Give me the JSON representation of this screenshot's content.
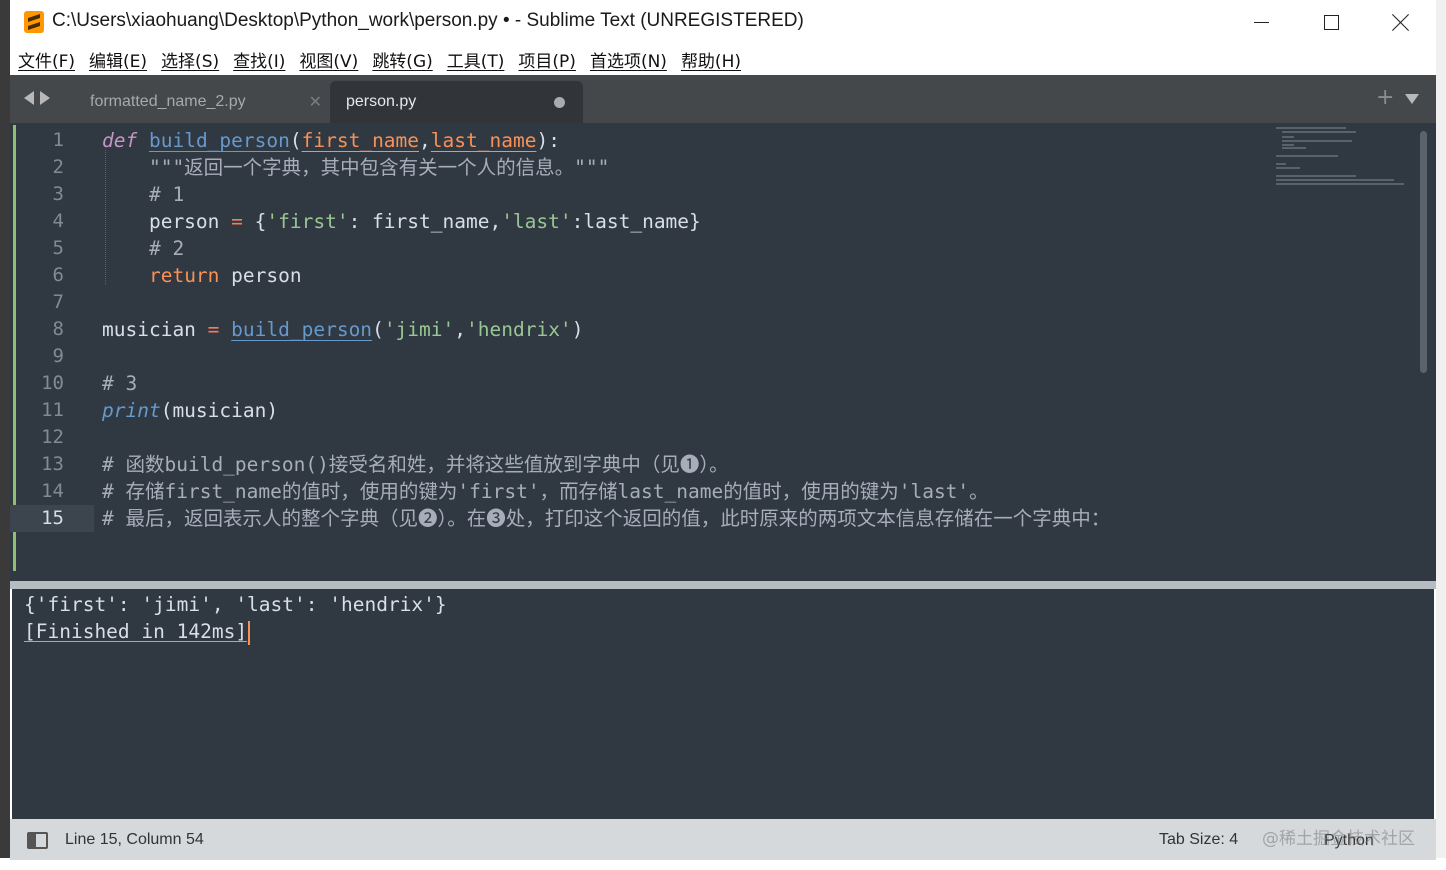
{
  "window": {
    "title": "C:\\Users\\xiaohuang\\Desktop\\Python_work\\person.py • - Sublime Text (UNREGISTERED)"
  },
  "menu": [
    "文件(F)",
    "编辑(E)",
    "选择(S)",
    "查找(I)",
    "视图(V)",
    "跳转(G)",
    "工具(T)",
    "项目(P)",
    "首选项(N)",
    "帮助(H)"
  ],
  "tabs": [
    {
      "label": "formatted_name_2.py",
      "active": false,
      "dirty": false
    },
    {
      "label": "person.py",
      "active": true,
      "dirty": true
    }
  ],
  "editor": {
    "current_line": 15,
    "line_numbers": [
      "1",
      "2",
      "3",
      "4",
      "5",
      "6",
      "7",
      "8",
      "9",
      "10",
      "11",
      "12",
      "13",
      "14",
      "15"
    ],
    "lines": [
      {
        "num": "1",
        "tokens": [
          {
            "t": "def",
            "c": "kw"
          },
          {
            "t": " ",
            "c": "pl"
          },
          {
            "t": "build_person",
            "c": "fn"
          },
          {
            "t": "(",
            "c": "pl"
          },
          {
            "t": "first_name",
            "c": "param"
          },
          {
            "t": ",",
            "c": "pl"
          },
          {
            "t": "last_name",
            "c": "param"
          },
          {
            "t": "):",
            "c": "pl"
          }
        ]
      },
      {
        "num": "2",
        "tokens": [
          {
            "t": "    \"\"\"返回一个字典，其中包含有关一个人的信息。\"\"\"",
            "c": "cmt"
          }
        ]
      },
      {
        "num": "3",
        "tokens": [
          {
            "t": "    # 1",
            "c": "cmt"
          }
        ]
      },
      {
        "num": "4",
        "tokens": [
          {
            "t": "    person ",
            "c": "pl"
          },
          {
            "t": "=",
            "c": "op"
          },
          {
            "t": " {",
            "c": "pl"
          },
          {
            "t": "'first'",
            "c": "str"
          },
          {
            "t": ": first_name,",
            "c": "pl"
          },
          {
            "t": "'last'",
            "c": "str"
          },
          {
            "t": ":last_name}",
            "c": "pl"
          }
        ]
      },
      {
        "num": "5",
        "tokens": [
          {
            "t": "    # 2",
            "c": "cmt"
          }
        ]
      },
      {
        "num": "6",
        "tokens": [
          {
            "t": "    ",
            "c": "pl"
          },
          {
            "t": "return",
            "c": "ret"
          },
          {
            "t": " person",
            "c": "pl"
          }
        ]
      },
      {
        "num": "7",
        "tokens": []
      },
      {
        "num": "8",
        "tokens": [
          {
            "t": "musician ",
            "c": "pl"
          },
          {
            "t": "=",
            "c": "op"
          },
          {
            "t": " ",
            "c": "pl"
          },
          {
            "t": "build_person",
            "c": "fn"
          },
          {
            "t": "(",
            "c": "pl"
          },
          {
            "t": "'jimi'",
            "c": "str"
          },
          {
            "t": ",",
            "c": "pl"
          },
          {
            "t": "'hendrix'",
            "c": "str"
          },
          {
            "t": ")",
            "c": "pl"
          }
        ]
      },
      {
        "num": "9",
        "tokens": []
      },
      {
        "num": "10",
        "tokens": [
          {
            "t": "# 3",
            "c": "cmt"
          }
        ]
      },
      {
        "num": "11",
        "tokens": [
          {
            "t": "print",
            "c": "bi"
          },
          {
            "t": "(musician)",
            "c": "pl"
          }
        ]
      },
      {
        "num": "12",
        "tokens": []
      },
      {
        "num": "13",
        "tokens": [
          {
            "t": "# 函数build_person()接受名和姓，并将这些值放到字典中（见❶）。",
            "c": "cmt"
          }
        ]
      },
      {
        "num": "14",
        "tokens": [
          {
            "t": "# 存储first_name的值时，使用的键为'first'，而存储last_name的值时，使用的键为'last'。",
            "c": "cmt"
          }
        ]
      },
      {
        "num": "15",
        "tokens": [
          {
            "t": "# 最后，返回表示人的整个字典（见❷）。在❸处，打印这个返回的值，此时原来的两项文本信息存储在一个字典中：",
            "c": "cmt"
          }
        ]
      }
    ]
  },
  "output": {
    "line1": "{'first': 'jimi', 'last': 'hendrix'}",
    "line2": "[Finished in 142ms]"
  },
  "status": {
    "position": "Line 15, Column 54",
    "tab_size": "Tab Size: 4",
    "syntax": "Python",
    "watermark": "@稀土掘金技术社区"
  },
  "colors": {
    "editor_bg": "#303841",
    "keyword": "#c595c5",
    "function": "#6699cc",
    "parameter": "#f99157",
    "string": "#99c794",
    "comment": "#a7adba",
    "operator": "#f97b58"
  }
}
